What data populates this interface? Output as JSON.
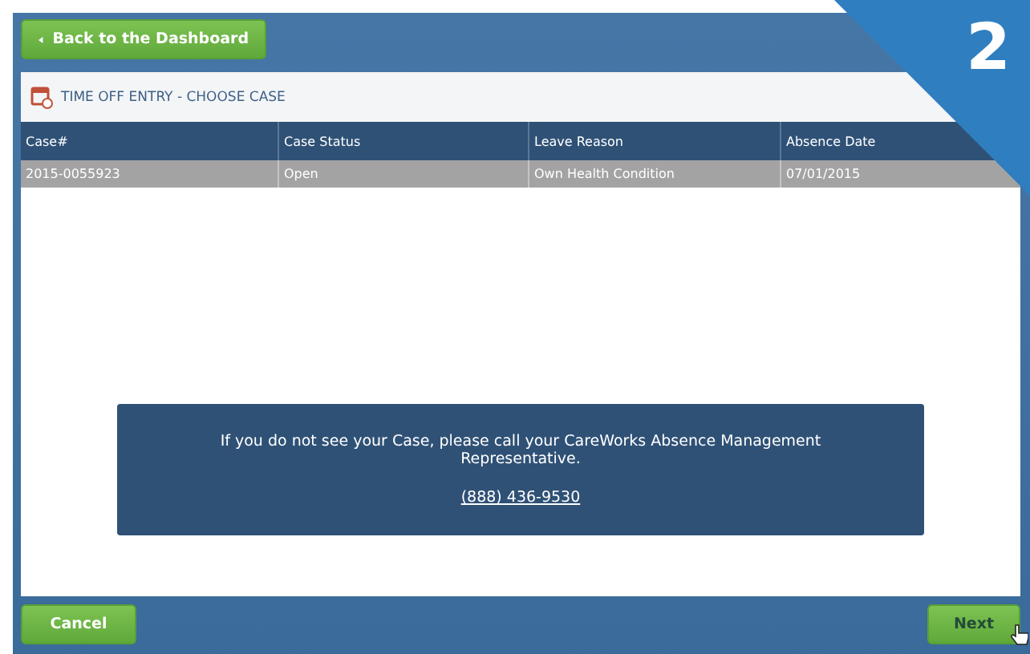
{
  "back_button": {
    "label": "Back to the Dashboard"
  },
  "step_badge": {
    "label": "2"
  },
  "panel": {
    "title": "TIME OFF ENTRY - CHOOSE CASE"
  },
  "table": {
    "columns": [
      "Case#",
      "Case Status",
      "Leave Reason",
      "Absence Date"
    ],
    "rows": [
      {
        "cells": [
          "2015-0055923",
          "Open",
          "Own Health Condition",
          "07/01/2015"
        ],
        "selected": true
      }
    ]
  },
  "notice": {
    "text": "If you do not see your Case, please call your CareWorks Absence Management Representative.",
    "phone": "(888) 436-9530"
  },
  "buttons": [
    {
      "label": "Cancel",
      "disabled": false
    },
    {
      "label": "Next",
      "disabled": true
    }
  ]
}
